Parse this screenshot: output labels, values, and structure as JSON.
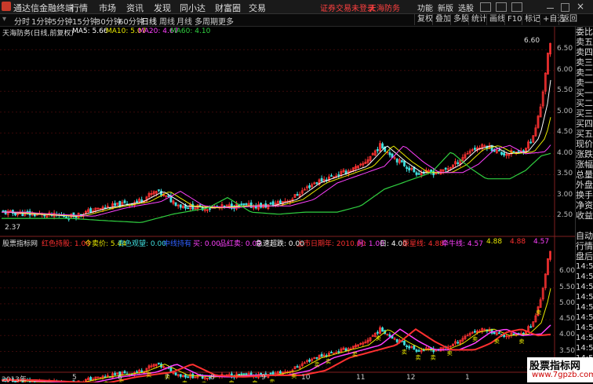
{
  "menubar": {
    "app_title": "通达信金融终端",
    "items": [
      "行情",
      "市场",
      "资讯",
      "发现",
      "同小达",
      "财富圈",
      "交易"
    ],
    "login_notice": "证券交易未登录",
    "stock_name": "天海防务",
    "right_items": [
      "功能",
      "新版",
      "选股"
    ]
  },
  "period": {
    "tabs": [
      "分时",
      "1分钟",
      "5分钟",
      "15分钟",
      "30分钟",
      "60分钟",
      "日线",
      "周线",
      "月线",
      "多周期",
      "更多"
    ],
    "selected": "日线",
    "tools": [
      "复权",
      "叠加",
      "多股",
      "统计",
      "画线",
      "F10",
      "标记",
      "+自选",
      "返回"
    ]
  },
  "main": {
    "stock_label": "天海防务(日线,前复权)",
    "ma": [
      {
        "label": "MA5: 5.66",
        "color": "#ffffff"
      },
      {
        "label": "MA10: 5.07",
        "color": "#e8e800"
      },
      {
        "label": "MA20: 4.67",
        "color": "#ff40ff"
      },
      {
        "label": "MA60: 4.10",
        "color": "#30d040"
      }
    ],
    "high_label": "6.60",
    "low_label": "2.37",
    "y_ticks": [
      "6.50",
      "6.00",
      "5.50",
      "5.00",
      "4.50",
      "4.00",
      "3.50",
      "3.00",
      "2.50"
    ]
  },
  "indicator": {
    "name": "股票指标网",
    "items": [
      {
        "label": "红色持股: 1.00",
        "color": "#ff3030"
      },
      {
        "label": "今卖价: 5.44",
        "color": "#e8e800"
      },
      {
        "label": "青色观望: 0.00",
        "color": "#40e0e0"
      },
      {
        "label": "中线持有",
        "color": "#3060ff"
      },
      {
        "label": "买: 0.00",
        "color": "#ff40ff"
      },
      {
        "label": "品红卖: 0.00",
        "color": "#ff40ff"
      },
      {
        "label": "急速超跌: 0.00",
        "color": "#ffffff"
      },
      {
        "label": "上市日期年: 2010.00",
        "color": "#ff3030"
      },
      {
        "label": "月: 1.00",
        "color": "#ff40ff"
      },
      {
        "label": "日: 4.00",
        "color": "#ffffff"
      },
      {
        "label": "原星线: 4.88",
        "color": "#ff3030"
      },
      {
        "label": "牵牛线: 4.57",
        "color": "#ff40ff"
      },
      {
        "label": "4.88",
        "color": "#e8e800"
      },
      {
        "label": "4.88",
        "color": "#ff3030"
      },
      {
        "label": "4.57",
        "color": "#ff40ff"
      }
    ],
    "y_ticks": [
      "6.00",
      "5.50",
      "5.00",
      "4.50",
      "4.00",
      "3.50",
      "3.00"
    ],
    "x_ticks": [
      "2013年",
      "5",
      "6",
      "7",
      "8",
      "9",
      "10",
      "11",
      "12",
      "1"
    ]
  },
  "rpanel": {
    "labels": [
      "委比",
      "卖五",
      "卖四",
      "卖三",
      "卖二",
      "卖一",
      "买一",
      "买二",
      "买三",
      "买四",
      "买五",
      "现价",
      "涨跌",
      "涨幅",
      "总量",
      "外盘",
      "换手",
      "净资",
      "收益",
      "",
      "自动",
      "行情",
      "盘后",
      "14:50",
      "14:50",
      "14:50",
      "14:50",
      "14:50",
      "14:50",
      "14:50",
      "14:50",
      "14:50",
      "14:50",
      "14:50"
    ]
  },
  "watermark": {
    "title": "股票指标网",
    "url": "www.7gpzb.com"
  },
  "colors": {
    "up": "#ff3232",
    "down": "#40e0e0",
    "ma5": "#ffffff",
    "ma10": "#e8e800",
    "ma20": "#ff40ff",
    "ma60": "#30d040"
  }
}
